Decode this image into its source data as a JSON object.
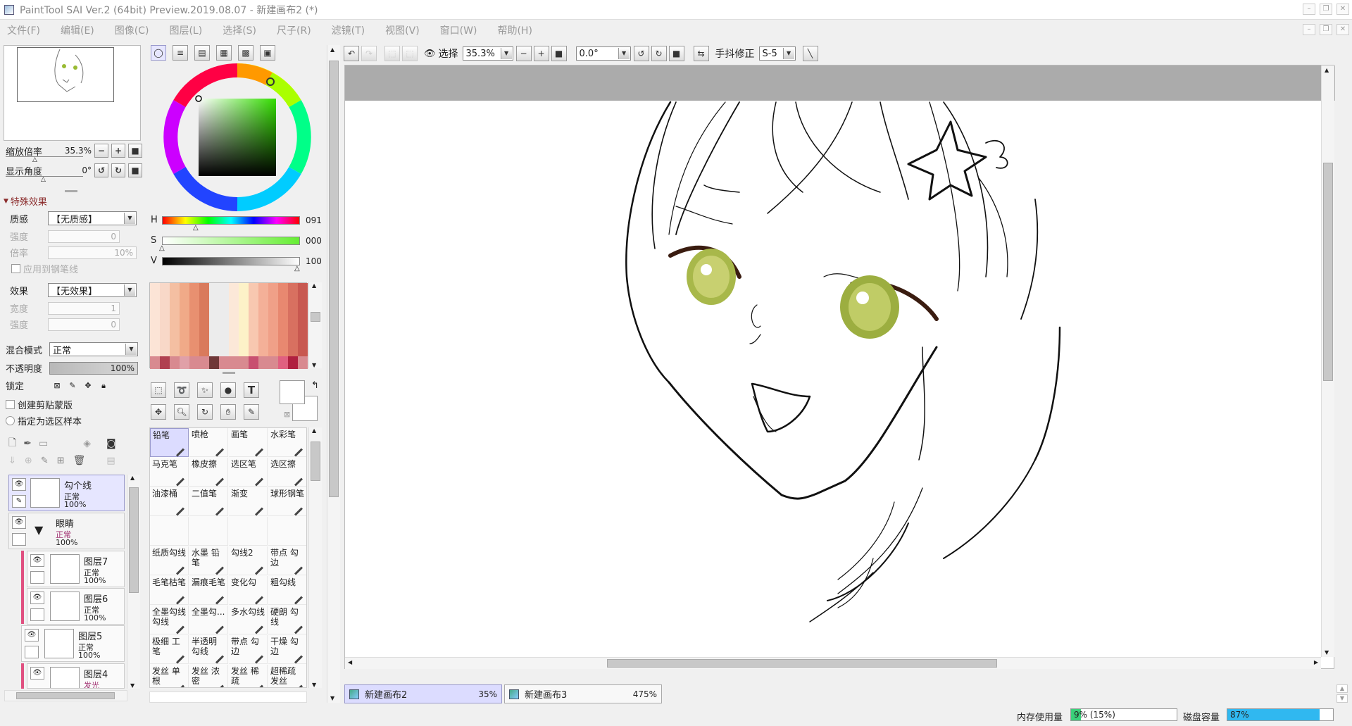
{
  "window": {
    "title": "PaintTool SAI Ver.2 (64bit) Preview.2019.08.07 - 新建画布2 (*)"
  },
  "menu": [
    "文件(F)",
    "编辑(E)",
    "图像(C)",
    "图层(L)",
    "选择(S)",
    "尺子(R)",
    "滤镜(T)",
    "视图(V)",
    "窗口(W)",
    "帮助(H)"
  ],
  "navigator": {
    "zoom_label": "缩放倍率",
    "zoom_value": "35.3%",
    "angle_label": "显示角度",
    "angle_value": "0°"
  },
  "effects": {
    "header": "特殊效果",
    "texture_label": "质感",
    "texture_value": "【无质感】",
    "strength_label": "强度",
    "strength_value": "0",
    "scale_label": "倍率",
    "scale_value": "10%",
    "apply_pen_label": "应用到钢笔线",
    "effect_label": "效果",
    "effect_value": "【无效果】",
    "width_label": "宽度",
    "width_value": "1",
    "strength2_label": "强度",
    "strength2_value": "0"
  },
  "layer_props": {
    "blend_label": "混合模式",
    "blend_value": "正常",
    "opacity_label": "不透明度",
    "opacity_value": "100%",
    "lock_label": "锁定",
    "clip_label": "创建剪贴蒙版",
    "sample_label": "指定为选区样本"
  },
  "layers": [
    {
      "name": "勾个线",
      "mode": "正常",
      "opacity": "100%"
    },
    {
      "name": "眼睛",
      "mode": "正常",
      "opacity": "100%"
    },
    {
      "name": "图层7",
      "mode": "正常",
      "opacity": "100%"
    },
    {
      "name": "图层6",
      "mode": "正常",
      "opacity": "100%"
    },
    {
      "name": "图层5",
      "mode": "正常",
      "opacity": "100%"
    },
    {
      "name": "图层4",
      "mode": "发光"
    }
  ],
  "color": {
    "h_label": "H",
    "h_value": "091",
    "s_label": "S",
    "s_value": "000",
    "v_label": "V",
    "v_value": "100"
  },
  "tools": [
    "铅笔",
    "喷枪",
    "画笔",
    "水彩笔",
    "马克笔",
    "橡皮擦",
    "选区笔",
    "选区擦",
    "油漆桶",
    "二值笔",
    "渐变",
    "球形钢笔",
    "",
    "",
    "",
    "",
    "纸质勾线",
    "水墨 铅笔",
    "勾线2",
    "带点 勾边",
    "毛笔枯笔",
    "漏痕毛笔",
    "变化勾",
    "粗勾线",
    "全墨勾线 勾线",
    "全墨勾...",
    "多水勾线",
    "硬朗 勾线",
    "极细 工笔",
    "半透明 勾线",
    "带点 勾边",
    "干燥 勾边",
    "发丝 单根",
    "发丝 浓密",
    "发丝 稀疏",
    "超稀疏 发丝"
  ],
  "toolbar": {
    "select_label": "选择",
    "zoom_value": "35.3%",
    "angle_value": "0.0°",
    "stabilizer_label": "手抖修正",
    "stabilizer_value": "S-5"
  },
  "documents": [
    {
      "name": "新建画布2",
      "zoom": "35%"
    },
    {
      "name": "新建画布3",
      "zoom": "475%"
    }
  ],
  "status": {
    "memory_label": "内存使用量",
    "memory_value": "9% (15%)",
    "memory_fraction": 0.09,
    "disk_label": "磁盘容量",
    "disk_value": "87%",
    "disk_fraction": 0.87
  },
  "colors": {
    "accent": "#9999cc",
    "section_header": "#8b2c2c",
    "layer_pink": "#e05080",
    "canvas_border": "#ababab",
    "memory_fill": "#3ad07a",
    "disk_fill": "#30b8f0"
  }
}
